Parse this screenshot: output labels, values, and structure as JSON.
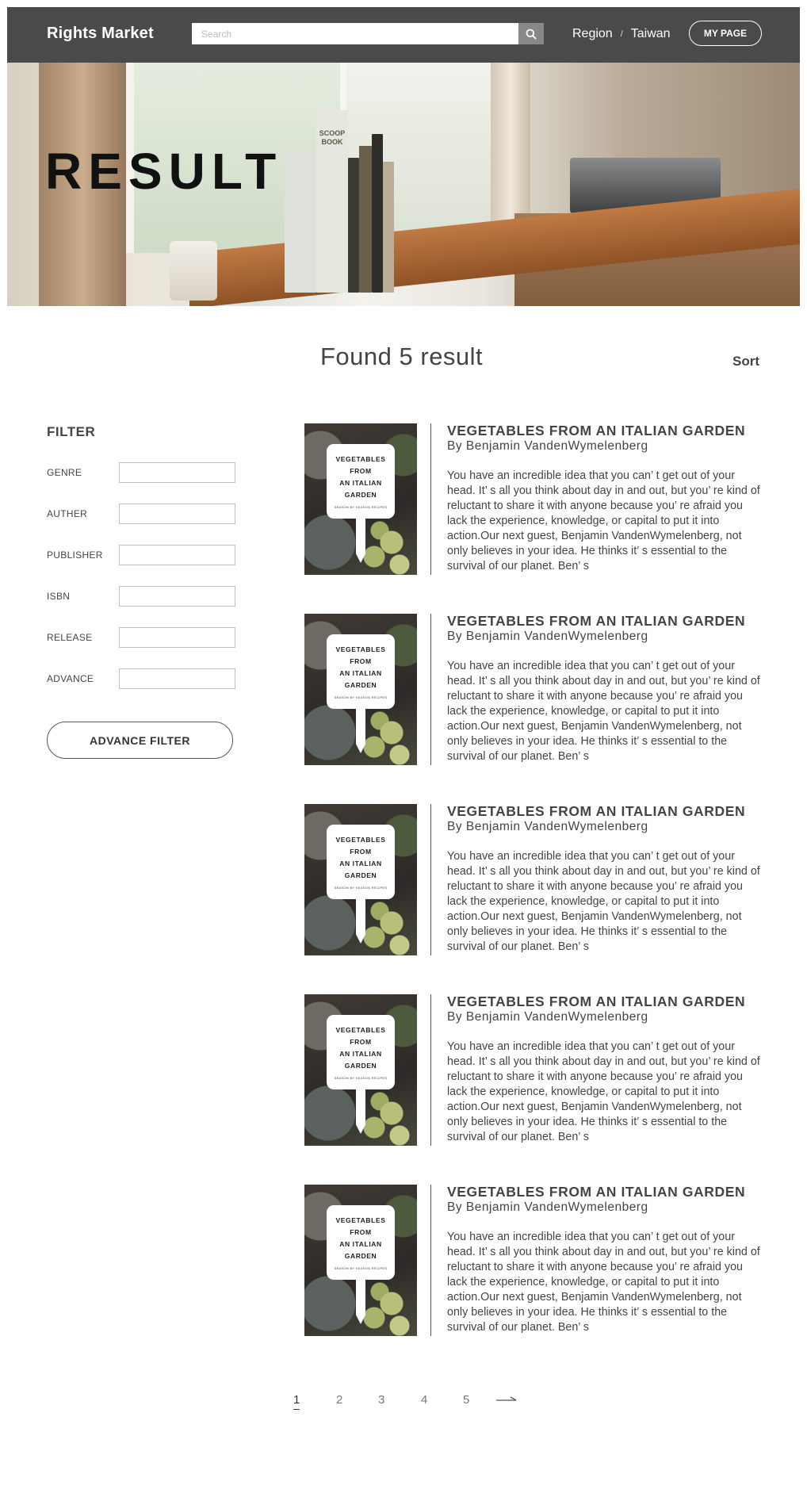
{
  "header": {
    "logo": "Rights Market",
    "search_placeholder": "Search",
    "region_label": "Region",
    "region_separator": "/",
    "region_value": "Taiwan",
    "mypage_label": "MY PAGE"
  },
  "hero": {
    "title": "RESULT",
    "book_spine_text": "SCOOP BOOK"
  },
  "results_bar": {
    "found_text": "Found 5 result",
    "sort_label": "Sort"
  },
  "filter": {
    "title": "FILTER",
    "fields": [
      {
        "label": "GENRE",
        "value": ""
      },
      {
        "label": "AUTHER",
        "value": ""
      },
      {
        "label": "PUBLISHER",
        "value": ""
      },
      {
        "label": "ISBN",
        "value": ""
      },
      {
        "label": "RELEASE",
        "value": ""
      },
      {
        "label": "ADVANCE",
        "value": ""
      }
    ],
    "button_label": "ADVANCE FILTER"
  },
  "results": [
    {
      "cover_line1": "VEGETABLES",
      "cover_line2": "FROM",
      "cover_line3": "AN ITALIAN",
      "cover_line4": "GARDEN",
      "cover_sub": "SEASON BY SEASON RECIPES",
      "title": "VEGETABLES FROM AN ITALIAN GARDEN",
      "author": "By Benjamin VandenWymelenberg",
      "description": "You have an incredible idea that you can’ t get out of your head. It’ s all you think about day in and out, but you’ re kind of reluctant to share it with anyone because you’ re afraid you lack the experience, knowledge, or capital to put it into action.Our next guest, Benjamin VandenWymelenberg, not only believes in your idea. He thinks it’ s essential to the survival of our planet. Ben’ s"
    },
    {
      "cover_line1": "VEGETABLES",
      "cover_line2": "FROM",
      "cover_line3": "AN ITALIAN",
      "cover_line4": "GARDEN",
      "cover_sub": "SEASON BY SEASON RECIPES",
      "title": "VEGETABLES FROM AN ITALIAN GARDEN",
      "author": "By Benjamin VandenWymelenberg",
      "description": "You have an incredible idea that you can’ t get out of your head. It’ s all you think about day in and out, but you’ re kind of reluctant to share it with anyone because you’ re afraid you lack the experience, knowledge, or capital to put it into action.Our next guest, Benjamin VandenWymelenberg, not only believes in your idea. He thinks it’ s essential to the survival of our planet. Ben’ s"
    },
    {
      "cover_line1": "VEGETABLES",
      "cover_line2": "FROM",
      "cover_line3": "AN ITALIAN",
      "cover_line4": "GARDEN",
      "cover_sub": "SEASON BY SEASON RECIPES",
      "title": "VEGETABLES FROM AN ITALIAN GARDEN",
      "author": "By Benjamin VandenWymelenberg",
      "description": "You have an incredible idea that you can’ t get out of your head. It’ s all you think about day in and out, but you’ re kind of reluctant to share it with anyone because you’ re afraid you lack the experience, knowledge, or capital to put it into action.Our next guest, Benjamin VandenWymelenberg, not only believes in your idea. He thinks it’ s essential to the survival of our planet. Ben’ s"
    },
    {
      "cover_line1": "VEGETABLES",
      "cover_line2": "FROM",
      "cover_line3": "AN ITALIAN",
      "cover_line4": "GARDEN",
      "cover_sub": "SEASON BY SEASON RECIPES",
      "title": "VEGETABLES FROM AN ITALIAN GARDEN",
      "author": "By Benjamin VandenWymelenberg",
      "description": "You have an incredible idea that you can’ t get out of your head. It’ s all you think about day in and out, but you’ re kind of reluctant to share it with anyone because you’ re afraid you lack the experience, knowledge, or capital to put it into action.Our next guest, Benjamin VandenWymelenberg, not only believes in your idea. He thinks it’ s essential to the survival of our planet. Ben’ s"
    },
    {
      "cover_line1": "VEGETABLES",
      "cover_line2": "FROM",
      "cover_line3": "AN ITALIAN",
      "cover_line4": "GARDEN",
      "cover_sub": "SEASON BY SEASON RECIPES",
      "title": "VEGETABLES FROM AN ITALIAN GARDEN",
      "author": "By Benjamin VandenWymelenberg",
      "description": "You have an incredible idea that you can’ t get out of your head. It’ s all you think about day in and out, but you’ re kind of reluctant to share it with anyone because you’ re afraid you lack the experience, knowledge, or capital to put it into action.Our next guest, Benjamin VandenWymelenberg, not only believes in your idea. He thinks it’ s essential to the survival of our planet. Ben’ s"
    }
  ],
  "pagination": {
    "pages": [
      "1",
      "2",
      "3",
      "4",
      "5"
    ],
    "current": "1",
    "next_icon": "arrow-right-icon"
  },
  "colors": {
    "header_bg": "#4a4a4a",
    "text": "#444444",
    "search_button": "#888888"
  }
}
